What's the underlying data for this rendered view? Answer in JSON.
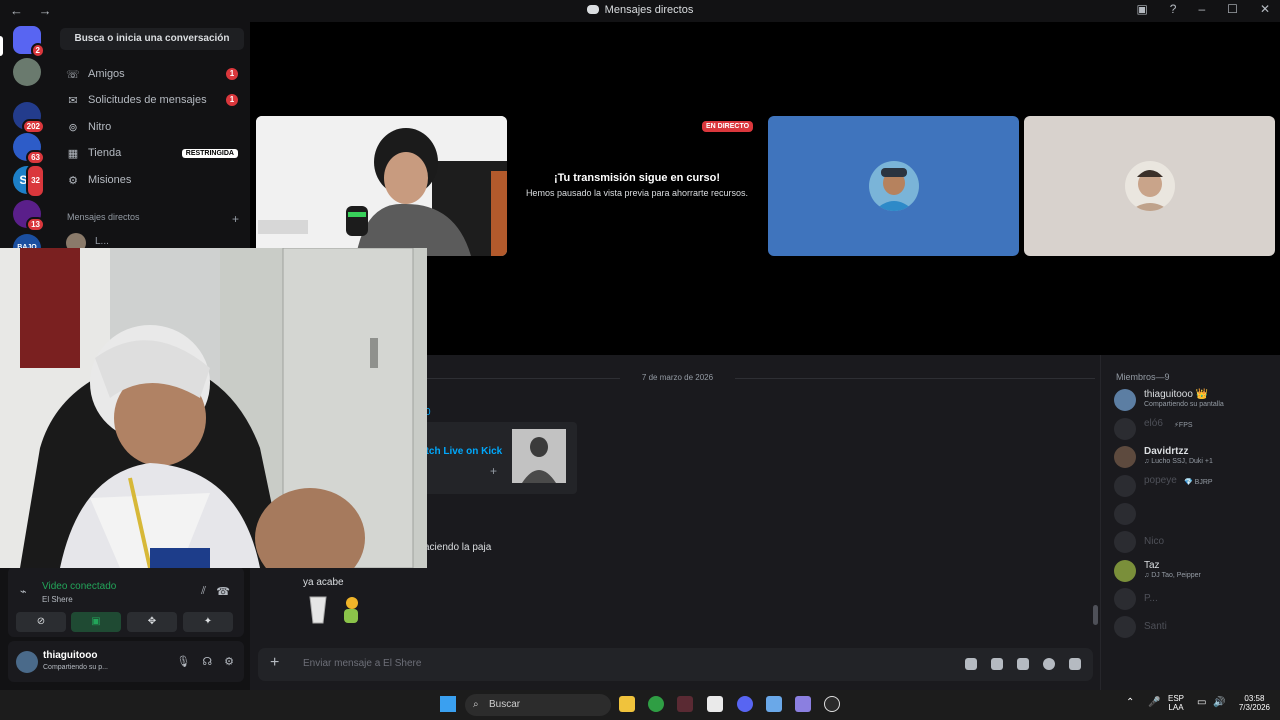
{
  "window": {
    "title": "Mensajes directos",
    "nav": "← →"
  },
  "servers": [
    {
      "badge": "2",
      "color": "#5865f2"
    },
    {
      "badge": "",
      "color": "#6a7a6e"
    },
    {
      "badge": "202",
      "color": "#233c8c"
    },
    {
      "badge": "63",
      "color": "#2d5cc8"
    },
    {
      "badge": "32",
      "color": "#1d7fc7",
      "label": "ST"
    },
    {
      "badge": "13",
      "color": "#5a1f8a"
    },
    {
      "badge": "",
      "color": "#1b4fa0",
      "label": "BAJO"
    }
  ],
  "sidebar": {
    "search": "Busca o inicia una conversación",
    "items": [
      {
        "label": "Amigos",
        "count": "1"
      },
      {
        "label": "Solicitudes de mensajes",
        "count": "1"
      },
      {
        "label": "Nitro",
        "count": ""
      },
      {
        "label": "Tienda",
        "tag": "RESTRINGIDA"
      },
      {
        "label": "Misiones",
        "count": ""
      }
    ],
    "dm_header": "Mensajes directos",
    "dm_first": "L..."
  },
  "stage": {
    "live_tag": "EN DIRECTO",
    "paused_title": "¡Tu transmisión sigue en curso!",
    "paused_sub": "Hemos pausado la vista previa para ahorrarte recursos."
  },
  "chat": {
    "date": "7 de marzo de 2026",
    "partial_name": "0",
    "embed_link": "atch Live on Kick",
    "msg1": "aciendo la paja",
    "msg2": "ya acabe",
    "composer_placeholder": "Enviar mensaje a El Shere"
  },
  "members": {
    "header": "Miembros—9",
    "list": [
      {
        "name": "thiaguitooo 👑",
        "status": "Compartiendo su pantalla",
        "dim": false,
        "color": "#5c7ea3"
      },
      {
        "name": "eló6",
        "status": "⚡FPS",
        "dim": true
      },
      {
        "name": "Davidrtzz",
        "status": "♫ Lucho SSJ, Duki +1",
        "dim": false,
        "color": "#5d4a3e"
      },
      {
        "name": "popeye",
        "status": "💎 BJRP",
        "dim": true
      },
      {
        "name": "ㅤ",
        "status": "",
        "dim": true
      },
      {
        "name": "Nico",
        "status": "",
        "dim": true
      },
      {
        "name": "Taz",
        "status": "♫ DJ Tao, Peipper",
        "dim": false,
        "color": "#7a8f3a"
      },
      {
        "name": "P...",
        "status": "",
        "dim": true
      },
      {
        "name": "Santi",
        "status": "",
        "dim": true
      }
    ]
  },
  "voice": {
    "title": "Video conectado",
    "sub": "El Shere"
  },
  "user": {
    "name": "thiaguitooo",
    "status": "Compartiendo su p..."
  },
  "taskbar": {
    "search": "Buscar",
    "lang": "ESP",
    "lang2": "LAA",
    "time": "03:58",
    "date": "7/3/2026"
  }
}
